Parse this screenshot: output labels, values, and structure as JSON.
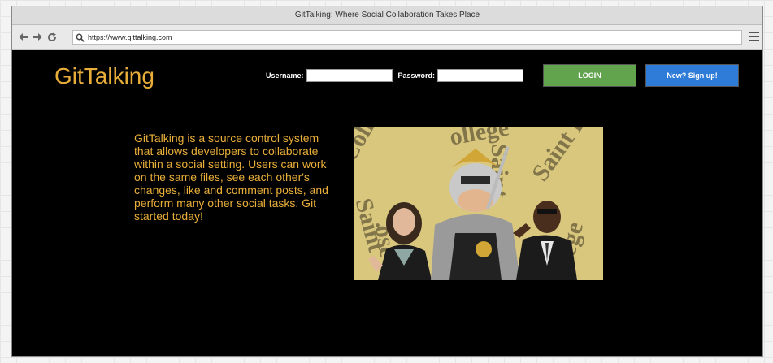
{
  "window": {
    "title": "GitTalking: Where Social Collaboration Takes Place"
  },
  "toolbar": {
    "url": "https://www.gittalking.com",
    "icons": [
      "back-arrow-icon",
      "forward-arrow-icon",
      "reload-icon",
      "search-icon",
      "hamburger-menu-icon"
    ]
  },
  "header": {
    "logo": "GitTalking",
    "username_label": "Username:",
    "password_label": "Password:",
    "username_value": "",
    "password_value": "",
    "login_label": "LOGIN",
    "signup_label": "New? Sign up!"
  },
  "main": {
    "description": "GitTalking is a source control system that allows developers to collaborate within a social setting. Users can work on the same files, see each other's changes, like and comment posts, and perform many other social tasks. Git started today!"
  },
  "colors": {
    "accent": "#e9ae3a",
    "login": "#62a34d",
    "signup": "#2f7bd8",
    "background": "#000000"
  }
}
